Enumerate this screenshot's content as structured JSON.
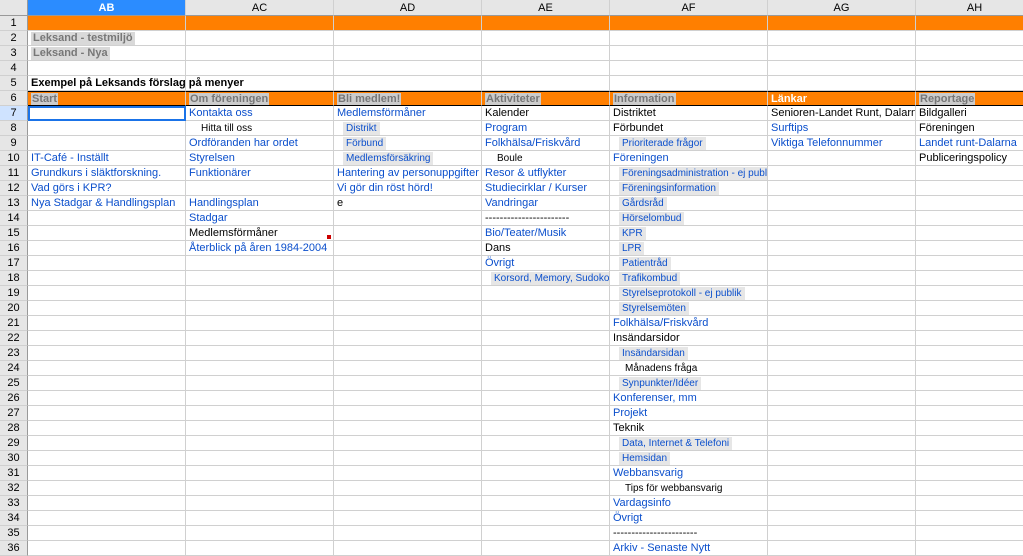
{
  "columns": [
    "AB",
    "AC",
    "AD",
    "AE",
    "AF",
    "AG",
    "AH"
  ],
  "row2": {
    "ab_pill": "Leksand - testmiljö"
  },
  "row3": {
    "ab_pill": "Leksand - Nya"
  },
  "row5": {
    "ab": "Exempel på Leksands förslag på menyer"
  },
  "row6": {
    "ab": "Start",
    "ac": "Om föreningen",
    "ad": "Bli medlem!",
    "ae": "Aktiviteter",
    "af": "Information",
    "ag": "Länkar",
    "ah": "Reportage"
  },
  "row7": {
    "ac": "Kontakta oss",
    "ad": "Medlemsförmåner",
    "ae": "Kalender",
    "af": "Distriktet",
    "ag": "Senioren-Landet Runt, Dalarna",
    "ah": "Bildgalleri"
  },
  "row8": {
    "ac": "Hitta till oss",
    "ad": "Distrikt",
    "ae": "Program",
    "af": "Förbundet",
    "ag": "Surftips",
    "ah": "Föreningen"
  },
  "row9": {
    "ac": "Ordföranden har ordet",
    "ad": "Förbund",
    "ae": "Folkhälsa/Friskvård",
    "af": "Prioriterade frågor",
    "ag": "Viktiga Telefonnummer",
    "ah": "Landet runt-Dalarna"
  },
  "row10": {
    "ab": "IT-Café - Inställt",
    "ac": "Styrelsen",
    "ad": "Medlemsförsäkring",
    "ae": "Boule",
    "af": "Föreningen",
    "ah": "Publiceringspolicy"
  },
  "row11": {
    "ab": "Grundkurs i släktforskning.",
    "ac": "Funktionärer",
    "ad": "Hantering av personuppgifter",
    "ae": "Resor & utflykter",
    "af": "Föreningsadministration - ej publik"
  },
  "row12": {
    "ab": "Vad görs i KPR?",
    "ad": "Vi gör din röst hörd!",
    "ae": "Studiecirklar / Kurser",
    "af": "Föreningsinformation"
  },
  "row13": {
    "ab": "Nya Stadgar & Handlingsplan",
    "ac": "Handlingsplan",
    "ad": "e",
    "ae": "Vandringar",
    "af": "Gårdsråd"
  },
  "row14": {
    "ac": "Stadgar",
    "ae": "-----------------------",
    "af": "Hörselombud"
  },
  "row15": {
    "ac": "Medlemsförmåner",
    "ae": "Bio/Teater/Musik",
    "af": "KPR"
  },
  "row16": {
    "ac": "Återblick på åren 1984-2004",
    "ae": "Dans",
    "af": "LPR"
  },
  "row17": {
    "ae": "Övrigt",
    "af": "Patientråd"
  },
  "row18": {
    "ae": "Korsord, Memory, Sudoko ..",
    "af": "Trafikombud"
  },
  "row19": {
    "af": "Styrelseprotokoll - ej publik"
  },
  "row20": {
    "af": "Styrelsemöten"
  },
  "row21": {
    "af": "Folkhälsa/Friskvård"
  },
  "row22": {
    "af": "Insändarsidor"
  },
  "row23": {
    "af": "Insändarsidan"
  },
  "row24": {
    "af": "Månadens fråga"
  },
  "row25": {
    "af": "Synpunkter/Idéer"
  },
  "row26": {
    "af": "Konferenser, mm"
  },
  "row27": {
    "af": "Projekt"
  },
  "row28": {
    "af": "Teknik"
  },
  "row29": {
    "af": "Data, Internet & Telefoni"
  },
  "row30": {
    "af": "Hemsidan"
  },
  "row31": {
    "af": "Webbansvarig"
  },
  "row32": {
    "af": "Tips för webbansvarig"
  },
  "row33": {
    "af": "Vardagsinfo"
  },
  "row34": {
    "af": "Övrigt"
  },
  "row35": {
    "af": "-----------------------"
  },
  "row36": {
    "af": "Arkiv - Senaste Nytt"
  }
}
